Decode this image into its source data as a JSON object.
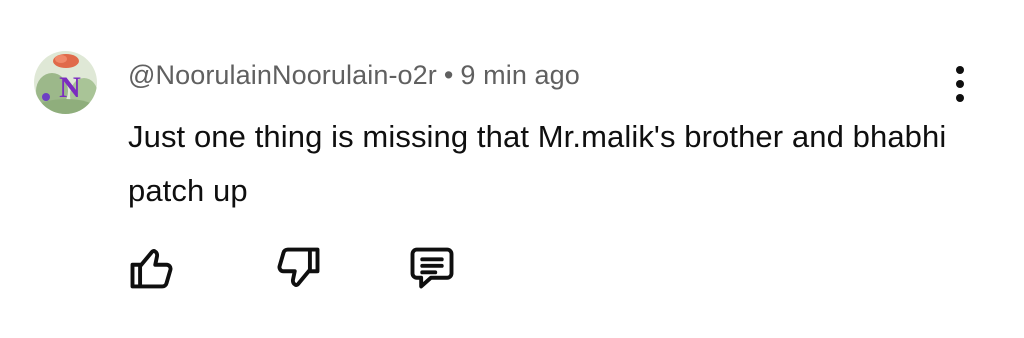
{
  "comment": {
    "author": "@NoorulainNoorulain-o2r",
    "separator": "•",
    "time": "9 min ago",
    "text": "Just one thing is missing that Mr.malik's brother and bhabhi patch up",
    "avatar_letter": "N"
  },
  "icons": {
    "more": "more-vert-icon",
    "like": "thumb-up-icon",
    "dislike": "thumb-down-icon",
    "reply": "reply-comment-icon"
  },
  "colors": {
    "meta_text": "#606060",
    "body_text": "#0f0f0f",
    "icon": "#0f0f0f",
    "avatar_letter": "#7b2cbf"
  }
}
